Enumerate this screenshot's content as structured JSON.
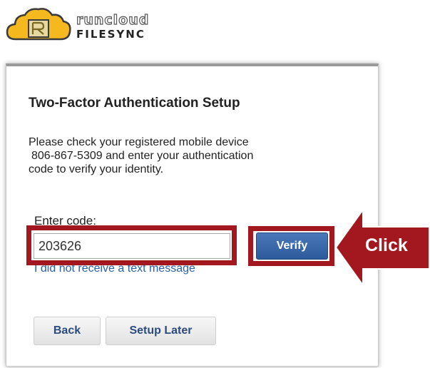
{
  "brand": {
    "name_top": "runcloud",
    "name_bottom": "FILESYNC",
    "logo_icon": "cloud-logo-icon"
  },
  "dialog": {
    "title": "Two-Factor Authentication Setup",
    "description_line1": "Please check your registered mobile device",
    "phone": "806-867-5309",
    "description_line2_suffix": "and enter your authentication",
    "description_line3": "code to verify your identity.",
    "code_label": "Enter code:",
    "code_value": "203626",
    "verify_label": "Verify",
    "resend_link": "I did not receive a text message",
    "back_label": "Back",
    "setup_later_label": "Setup Later"
  },
  "annotation": {
    "callout_label": "Click",
    "highlight_color": "#a3171f"
  },
  "colors": {
    "verify_button": "#2d5a9a",
    "link": "#2a5ea8",
    "secondary_button_text": "#2a4b7d"
  }
}
